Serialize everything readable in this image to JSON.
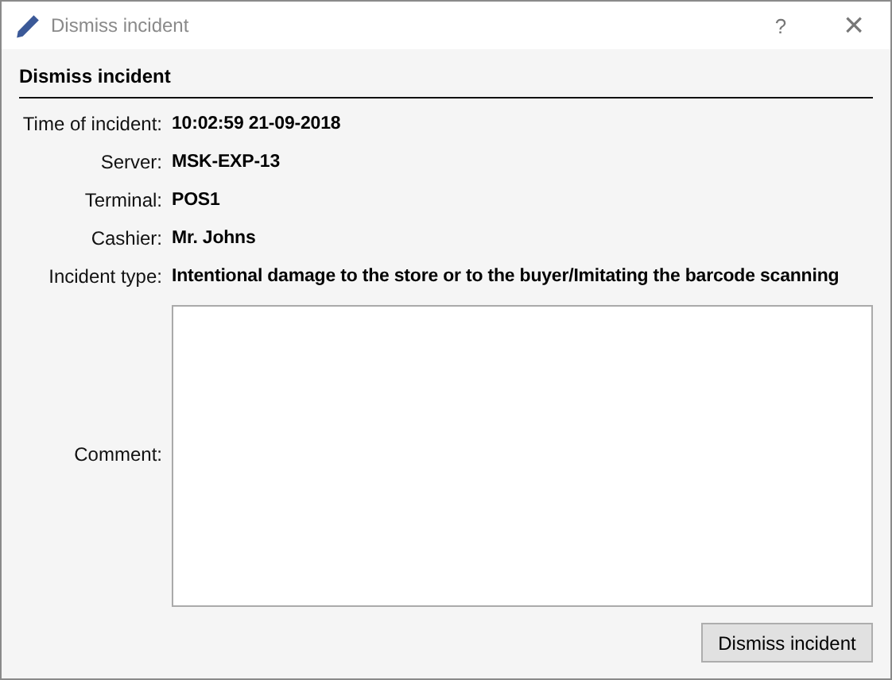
{
  "window": {
    "title": "Dismiss incident",
    "help": "?",
    "close": "×"
  },
  "heading": "Dismiss incident",
  "fields": [
    {
      "label": "Time of incident:",
      "value": "10:02:59 21-09-2018"
    },
    {
      "label": "Server:",
      "value": "MSK-EXP-13"
    },
    {
      "label": "Terminal:",
      "value": "POS1"
    },
    {
      "label": "Cashier:",
      "value": "Mr. Johns"
    },
    {
      "label": "Incident type:",
      "value": "Intentional damage to the store or to the buyer/Imitating the barcode scanning"
    }
  ],
  "comment": {
    "label": "Comment:"
  },
  "buttons": [
    "Dismiss incident"
  ]
}
